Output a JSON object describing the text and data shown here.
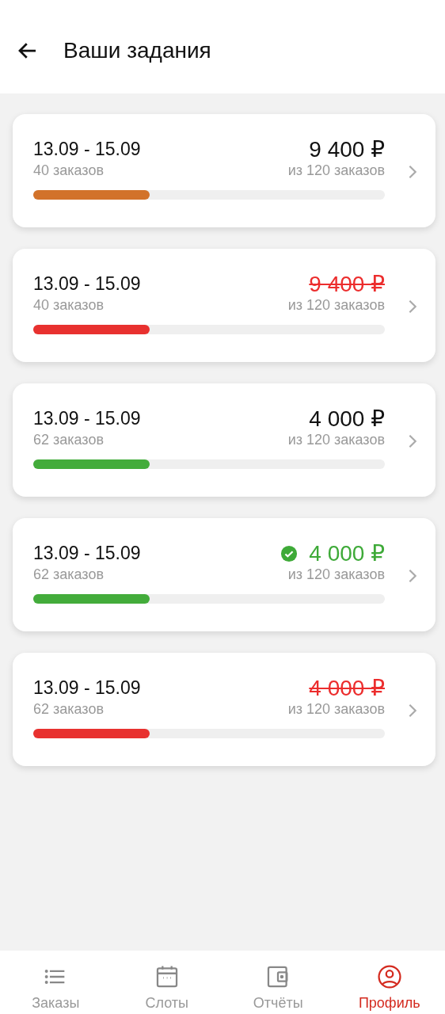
{
  "header": {
    "title": "Ваши задания"
  },
  "tasks": [
    {
      "dates": "13.09 - 15.09",
      "orders": "40 заказов",
      "amount": "9 400 ₽",
      "total": "из 120 заказов",
      "kind": "active",
      "level": 0.33,
      "color": "#d2722a"
    },
    {
      "dates": "13.09 - 15.09",
      "orders": "40 заказов",
      "amount": "9 400 ₽",
      "total": "из 120 заказов",
      "kind": "failed",
      "level": 0.33,
      "color": "#e8312f"
    },
    {
      "dates": "13.09 - 15.09",
      "orders": "62 заказов",
      "amount": "4 000 ₽",
      "total": "из 120 заказов",
      "kind": "active",
      "level": 0.33,
      "color": "#43ac3b"
    },
    {
      "dates": "13.09 - 15.09",
      "orders": "62 заказов",
      "amount": "4 000 ₽",
      "total": "из 120 заказов",
      "kind": "completed",
      "level": 0.33,
      "color": "#43ac3b"
    },
    {
      "dates": "13.09 - 15.09",
      "orders": "62 заказов",
      "amount": "4 000 ₽",
      "total": "из 120 заказов",
      "kind": "failed",
      "level": 0.33,
      "color": "#e8312f"
    }
  ],
  "nav": [
    {
      "label": "Заказы",
      "kind": "list",
      "selected": false
    },
    {
      "label": "Слоты",
      "kind": "calendar",
      "selected": false
    },
    {
      "label": "Отчёты",
      "kind": "wallet",
      "selected": false
    },
    {
      "label": "Профиль",
      "kind": "profile",
      "selected": true
    }
  ]
}
